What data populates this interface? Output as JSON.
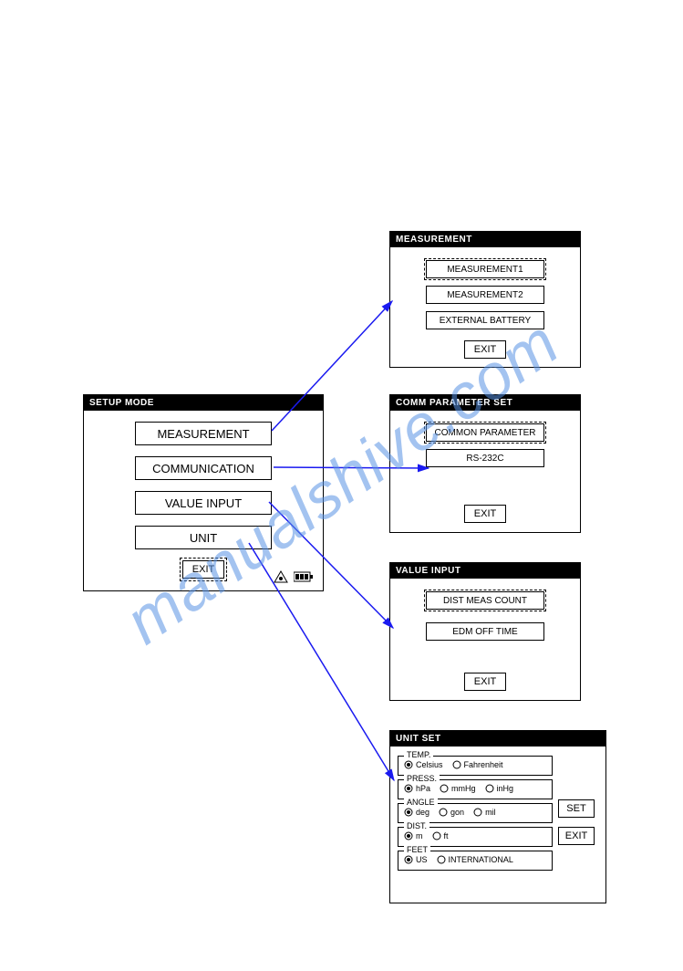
{
  "watermark": "manualshive.com",
  "setup": {
    "title": "SETUP MODE",
    "menu": [
      "MEASUREMENT",
      "COMMUNICATION",
      "VALUE INPUT",
      "UNIT"
    ],
    "exit": "EXIT"
  },
  "measurement": {
    "title": "MEASUREMENT",
    "options": [
      "MEASUREMENT1",
      "MEASUREMENT2",
      "EXTERNAL BATTERY"
    ],
    "selected": 0,
    "exit": "EXIT"
  },
  "comm": {
    "title": "COMM PARAMETER SET",
    "options": [
      "COMMON PARAMETER",
      "RS-232C"
    ],
    "selected": 0,
    "exit": "EXIT"
  },
  "valueinput": {
    "title": "VALUE INPUT",
    "options": [
      "DIST MEAS COUNT",
      "EDM OFF TIME"
    ],
    "selected": 0,
    "exit": "EXIT"
  },
  "unitset": {
    "title": "UNIT SET",
    "groups": {
      "temp": {
        "label": "TEMP.",
        "options": [
          "Celsius",
          "Fahrenheit"
        ],
        "selected": 0
      },
      "press": {
        "label": "PRESS.",
        "options": [
          "hPa",
          "mmHg",
          "inHg"
        ],
        "selected": 0
      },
      "angle": {
        "label": "ANGLE",
        "options": [
          "deg",
          "gon",
          "mil"
        ],
        "selected": 0
      },
      "dist": {
        "label": "DIST.",
        "options": [
          "m",
          "ft"
        ],
        "selected": 0
      },
      "feet": {
        "label": "FEET",
        "options": [
          "US",
          "INTERNATIONAL"
        ],
        "selected": 0
      }
    },
    "set": "SET",
    "exit": "EXIT"
  }
}
